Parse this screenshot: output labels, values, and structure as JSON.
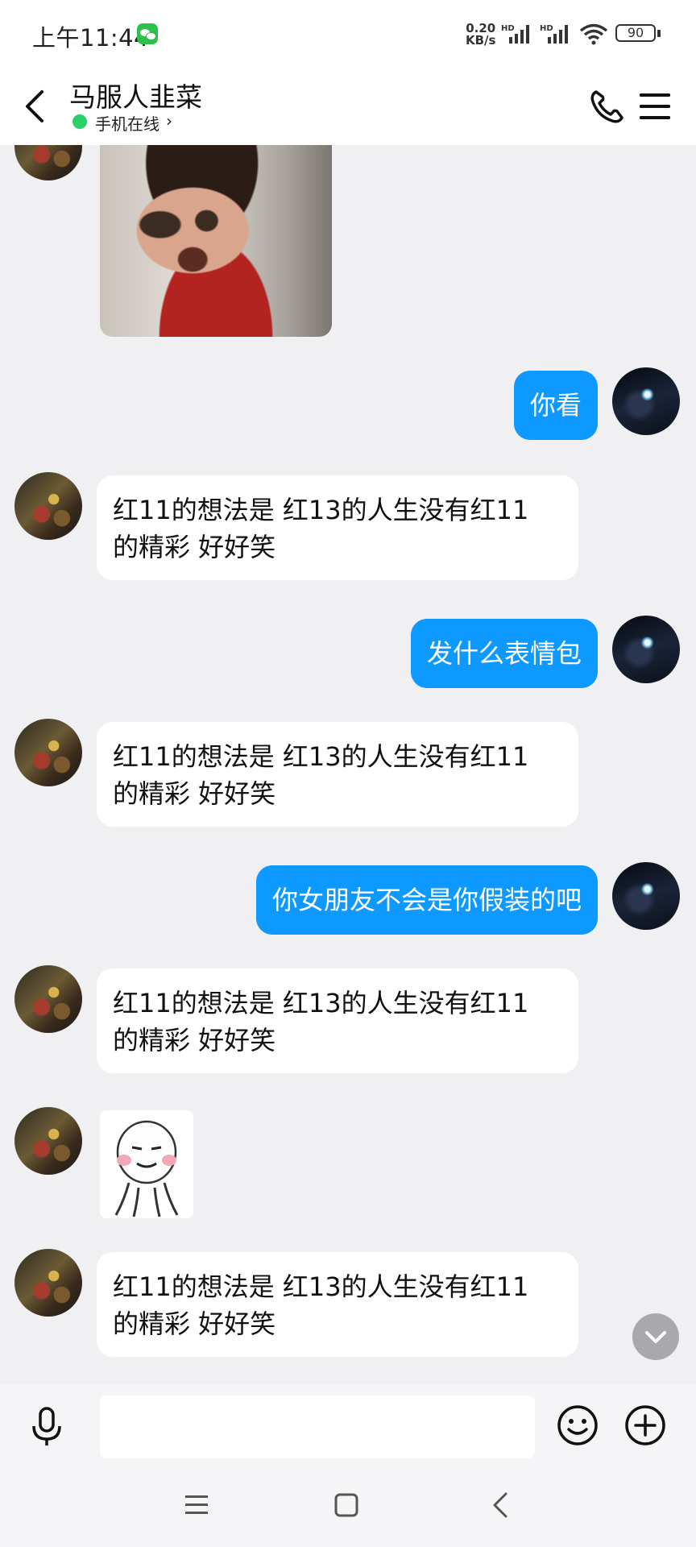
{
  "status_bar": {
    "time": "上午11:44",
    "net_speed_value": "0.20",
    "net_speed_unit": "KB/s",
    "signal_badge": "HD",
    "battery": "90"
  },
  "header": {
    "title": "马服人韭菜",
    "status": "手机在线",
    "status_chevron": "›"
  },
  "messages": [
    {
      "from": "friend",
      "type": "image",
      "content": "spider-man-meme"
    },
    {
      "from": "me",
      "type": "text",
      "text": "你看"
    },
    {
      "from": "friend",
      "type": "text",
      "line1": "红11的想法是 红13的人生没有红11",
      "line2": "的精彩 好好笑"
    },
    {
      "from": "me",
      "type": "text",
      "text": "发什么表情包"
    },
    {
      "from": "friend",
      "type": "text",
      "line1": "红11的想法是 红13的人生没有红11",
      "line2": "的精彩 好好笑"
    },
    {
      "from": "me",
      "type": "text",
      "text": "你女朋友不会是你假装的吧"
    },
    {
      "from": "friend",
      "type": "text",
      "line1": "红11的想法是 红13的人生没有红11",
      "line2": "的精彩 好好笑"
    },
    {
      "from": "friend",
      "type": "sticker",
      "content": "panda-face-sticker"
    },
    {
      "from": "friend",
      "type": "text",
      "line1": "红11的想法是 红13的人生没有红11",
      "line2": "的精彩 好好笑"
    }
  ],
  "input": {
    "placeholder": ""
  },
  "colors": {
    "accent": "#0d99ff",
    "background": "#f0f0f3",
    "online": "#2ccf6b"
  },
  "icons": [
    "back-arrow-icon",
    "phone-icon",
    "menu-icon",
    "microphone-icon",
    "emoji-icon",
    "plus-icon",
    "chevron-down-icon",
    "nav-menu-icon",
    "nav-home-icon",
    "nav-back-icon"
  ]
}
